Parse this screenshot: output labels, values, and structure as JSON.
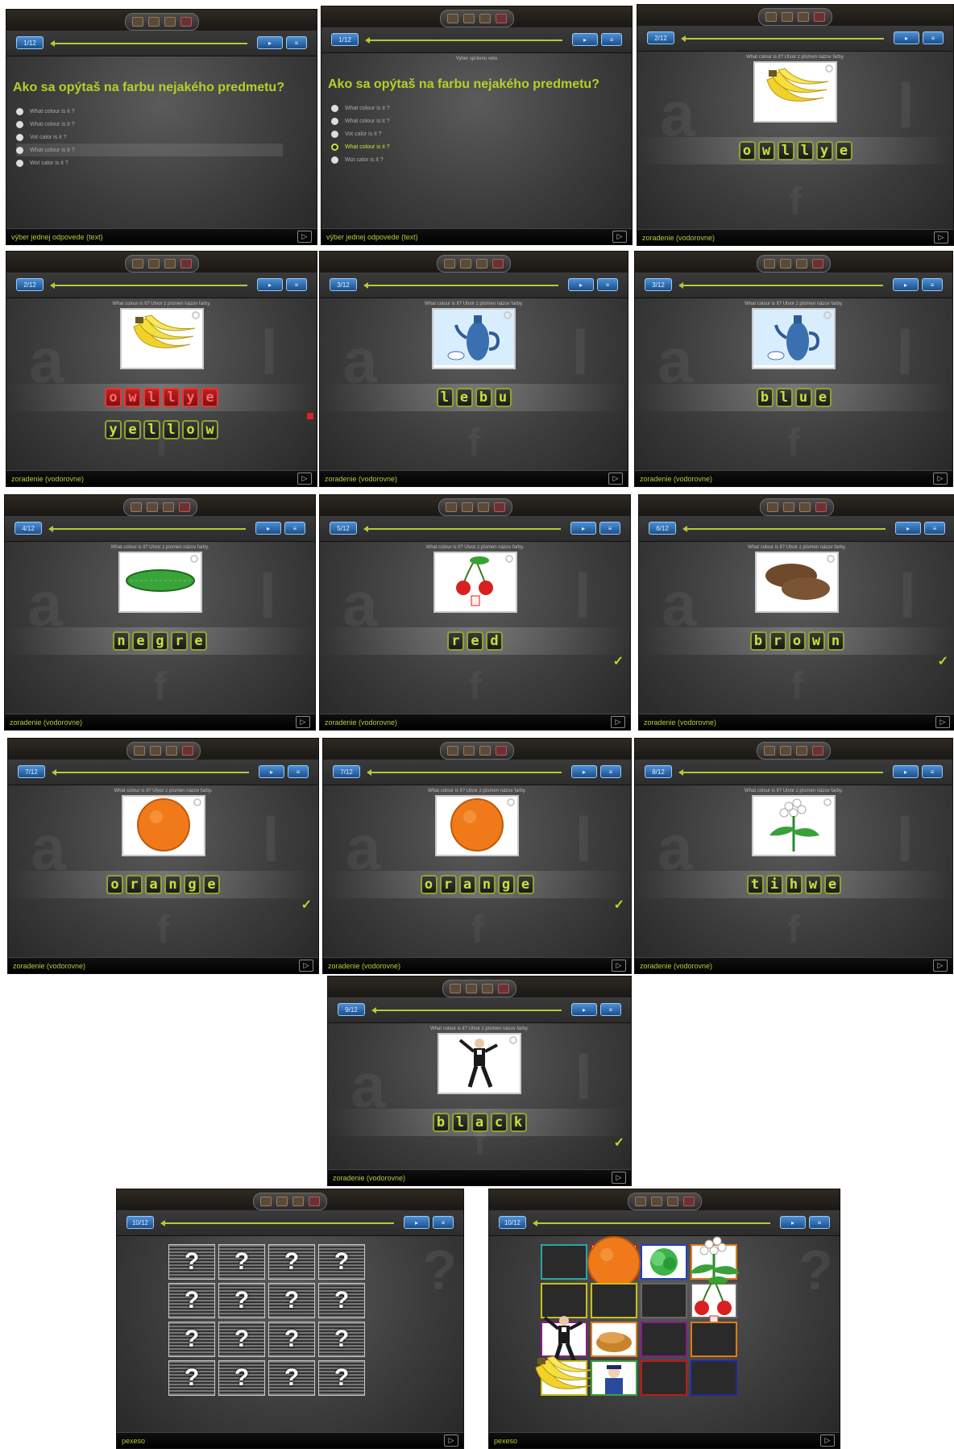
{
  "panels": [
    {
      "id": "p1",
      "type": "question",
      "counter": "1/12",
      "question": "Ako sa opýtaš na farbu nejakého predmetu?",
      "subtitle": "",
      "options": [
        "What colour is it ?",
        "What colour is it ?",
        "Vot calor is it ?",
        "What colour is it ?",
        "Wot calor is it ?"
      ],
      "footer": "výber jednej odpovede (text)"
    },
    {
      "id": "p2",
      "type": "question",
      "counter": "1/12",
      "question": "Ako sa opýtaš na farbu nejakého predmetu?",
      "subtitle": "Vyber správnu vetu",
      "options": [
        "What colour is it ?",
        "What colour is it ?",
        "Vot calor is it ?",
        "What colour is it ?",
        "Wot calor is it ?"
      ],
      "footer": "výber jednej odpovede (text)"
    },
    {
      "id": "p3",
      "type": "word",
      "counter": "2/12",
      "subtitle": "What colour is it? Utvor z písmen názov farby.",
      "image": "banana-icon",
      "letters": [
        "o",
        "w",
        "l",
        "l",
        "y",
        "e"
      ],
      "answer": [],
      "state": "",
      "footer": "zoradenie (vodorovne)"
    },
    {
      "id": "p4",
      "type": "word",
      "counter": "2/12",
      "subtitle": "What colour is it? Utvor z písmen názov farby.",
      "image": "banana-icon",
      "letters": [
        "o",
        "w",
        "l",
        "l",
        "y",
        "e"
      ],
      "answer": [
        "y",
        "e",
        "l",
        "l",
        "o",
        "w"
      ],
      "state": "wrong",
      "footer": "zoradenie (vodorovne)"
    },
    {
      "id": "p5",
      "type": "word",
      "counter": "3/12",
      "subtitle": "What colour is it? Utvor z písmen názov farby.",
      "image": "teapot-icon",
      "letters": [
        "l",
        "e",
        "b",
        "u"
      ],
      "answer": [],
      "state": "",
      "footer": "zoradenie (vodorovne)"
    },
    {
      "id": "p6",
      "type": "word",
      "counter": "3/12",
      "subtitle": "What colour is it? Utvor z písmen názov farby.",
      "image": "teapot-icon",
      "letters": [
        "b",
        "l",
        "u",
        "e"
      ],
      "answer": [],
      "state": "",
      "footer": "zoradenie (vodorovne)"
    },
    {
      "id": "p7",
      "type": "word",
      "counter": "4/12",
      "subtitle": "What colour is it? Utvor z písmen názov farby.",
      "image": "cucumber-icon",
      "letters": [
        "n",
        "e",
        "g",
        "r",
        "e"
      ],
      "answer": [],
      "state": "",
      "footer": "zoradenie (vodorovne)"
    },
    {
      "id": "p8",
      "type": "word",
      "counter": "5/12",
      "subtitle": "What colour is it? Utvor z písmen názov farby.",
      "image": "cherries-icon",
      "letters": [
        "r",
        "e",
        "d"
      ],
      "answer": [],
      "state": "ok",
      "footer": "zoradenie (vodorovne)"
    },
    {
      "id": "p9",
      "type": "word",
      "counter": "6/12",
      "subtitle": "What colour is it? Utvor z písmen názov farby.",
      "image": "potatoes-icon",
      "letters": [
        "b",
        "r",
        "o",
        "w",
        "n"
      ],
      "answer": [],
      "state": "ok",
      "footer": "zoradenie (vodorovne)"
    },
    {
      "id": "p10",
      "type": "word",
      "counter": "7/12",
      "subtitle": "What colour is it? Utvor z písmen názov farby.",
      "image": "orange-icon",
      "letters": [
        "o",
        "r",
        "a",
        "n",
        "g",
        "e"
      ],
      "answer": [],
      "state": "ok",
      "footer": "zoradenie (vodorovne)"
    },
    {
      "id": "p11",
      "type": "word",
      "counter": "7/12",
      "subtitle": "What colour is it? Utvor z písmen názov farby.",
      "image": "orange-icon",
      "letters": [
        "o",
        "r",
        "a",
        "n",
        "g",
        "e"
      ],
      "answer": [],
      "state": "ok",
      "footer": "zoradenie (vodorovne)"
    },
    {
      "id": "p12",
      "type": "word",
      "counter": "8/12",
      "subtitle": "What colour is it? Utvor z písmen názov farby.",
      "image": "flower-icon",
      "letters": [
        "t",
        "i",
        "h",
        "w",
        "e"
      ],
      "answer": [],
      "state": "",
      "footer": "zoradenie (vodorovne)"
    },
    {
      "id": "p13",
      "type": "word",
      "counter": "9/12",
      "subtitle": "What colour is it? Utvor z písmen názov farby.",
      "image": "dancer-icon",
      "letters": [
        "b",
        "l",
        "a",
        "c",
        "k"
      ],
      "answer": [],
      "state": "ok",
      "footer": "zoradenie (vodorovne)"
    },
    {
      "id": "p14",
      "type": "pexeso",
      "counter": "10/12",
      "cards": [
        "?",
        "?",
        "?",
        "?",
        "?",
        "?",
        "?",
        "?",
        "?",
        "?",
        "?",
        "?",
        "?",
        "?",
        "?",
        "?"
      ],
      "footer": "pexeso"
    },
    {
      "id": "p15",
      "type": "pexeso-open",
      "counter": "10/12",
      "cards": [
        "empty-c1",
        "orange-icon",
        "lettuce-icon",
        "flower-icon",
        "empty-c2",
        "empty-c2",
        "empty-c9",
        "cherries-icon",
        "dancer-icon",
        "bread-icon",
        "empty-c5",
        "empty-c4",
        "banana-icon",
        "police-icon",
        "empty-c7",
        "empty-c8"
      ],
      "footer": "pexeso"
    }
  ],
  "colors": {
    "accent": "#b5d128",
    "tile_border": "#8da42e",
    "wrong": "#d22222",
    "nav_blue": "#2a6ab8"
  }
}
